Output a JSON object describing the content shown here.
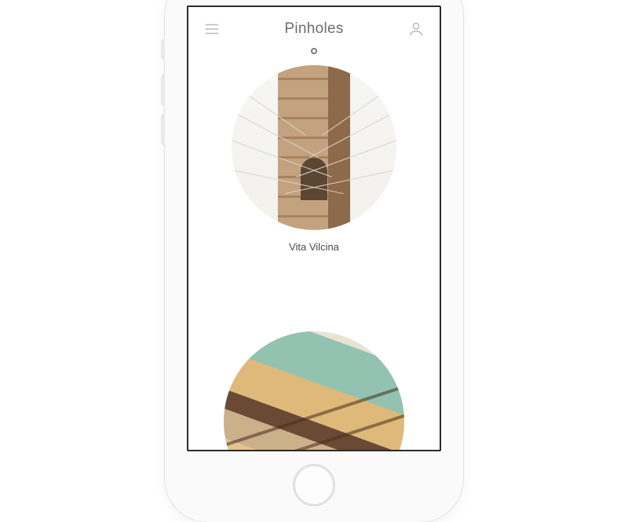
{
  "header": {
    "title": "Pinholes",
    "menu_icon": "hamburger",
    "profile_icon": "user"
  },
  "feed": {
    "items": [
      {
        "caption": "Vita Vilcina"
      },
      {
        "caption": ""
      }
    ]
  }
}
